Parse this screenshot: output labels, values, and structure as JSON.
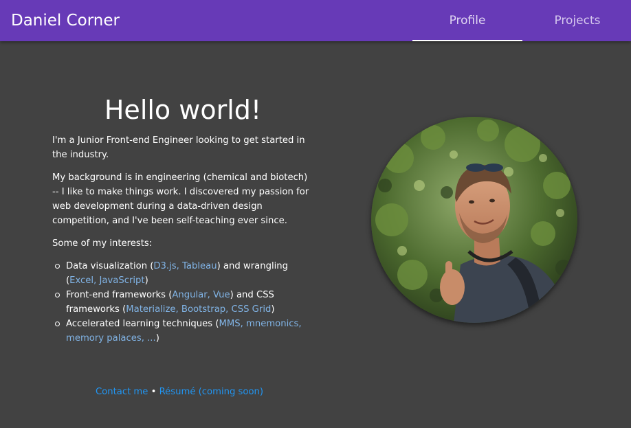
{
  "nav": {
    "brand": "Daniel Corner",
    "tabs": [
      {
        "label": "Profile",
        "active": true
      },
      {
        "label": "Projects",
        "active": false
      }
    ]
  },
  "main": {
    "title": "Hello world!",
    "intro": "I'm a Junior Front-end Engineer looking to get started in the industry.",
    "background": "My background is in engineering (chemical and biotech) -- I like to make things work. I discovered my passion for web development during a data-driven design competition, and I've been self-teaching ever since.",
    "interests_heading": "Some of my interests:",
    "interests": [
      {
        "pre": "Data visualization (",
        "link1": "D3.js, Tableau",
        "mid": ") and wrangling (",
        "link2": "Excel, JavaScript",
        "post": ")"
      },
      {
        "pre": "Front-end frameworks (",
        "link1": "Angular, Vue",
        "mid": ") and CSS frameworks (",
        "link2": "Materialize, Bootstrap, CSS Grid",
        "post": ")"
      },
      {
        "pre": "Accelerated learning techniques (",
        "link1": "MMS, mnemonics, memory palaces, ...",
        "post": ")"
      }
    ]
  },
  "footer": {
    "contact": "Contact me",
    "separator": " • ",
    "resume": "Résumé (coming soon)"
  },
  "photo": {
    "alt": "profile-photo",
    "description_icon": "person-portrait"
  },
  "colors": {
    "navbar": "#673ab7",
    "page_background": "#424242",
    "link_light": "#81b4e6",
    "link_footer": "#2196f3"
  }
}
